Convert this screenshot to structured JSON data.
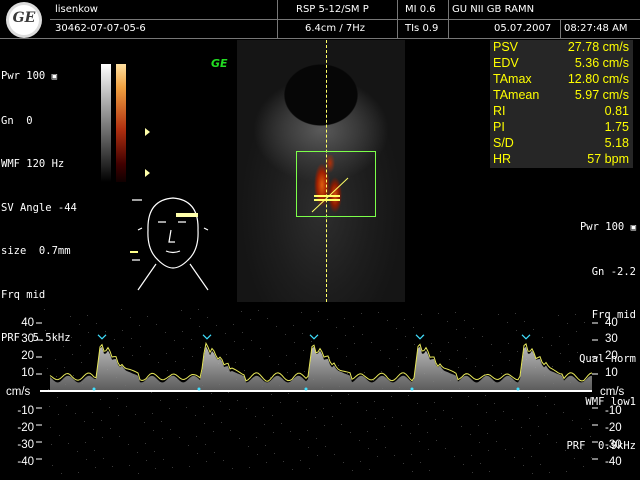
{
  "header": {
    "patient_name": "lisenkow",
    "patient_id": "30462-07-07-05-6",
    "probe": "RSP 5-12/SM P",
    "depth_freq": "6.4cm / 7Hz",
    "mi": "MI  0.6",
    "tis": "TIs  0.9",
    "institution": "GU NII GB RAMN",
    "date": "05.07.2007",
    "time": "08:27:48 AM"
  },
  "left_params": [
    "Pwr 100",
    "Gn  0",
    "WMF 120 Hz",
    "SV Angle -44",
    "size  0.7mm",
    "Frq mid",
    "PRF  5.5kHz"
  ],
  "brand_mark": "GE",
  "measurements": [
    {
      "label": "PSV",
      "value": "27.78 cm/s"
    },
    {
      "label": "EDV",
      "value": "5.36 cm/s"
    },
    {
      "label": "TAmax",
      "value": "12.80 cm/s"
    },
    {
      "label": "TAmean",
      "value": "5.97 cm/s"
    },
    {
      "label": "RI",
      "value": "0.81"
    },
    {
      "label": "PI",
      "value": "1.75"
    },
    {
      "label": "S/D",
      "value": "5.18"
    },
    {
      "label": "HR",
      "value": "57 bpm"
    }
  ],
  "right_params": [
    "Pwr 100",
    "Gn -2.2",
    "Frq mid",
    "Qual norm",
    "WMF low1",
    "PRF  0.9kHz"
  ],
  "doppler_scale": {
    "unit": "cm/s",
    "positive_ticks": [
      "40",
      "30",
      "20",
      "10"
    ],
    "negative_ticks": [
      "-10",
      "-20",
      "-30",
      "-40"
    ]
  },
  "colors": {
    "text": "#ffffff",
    "measurement_text": "#ffff00",
    "roi_box": "#7cff4a",
    "envelope": "#e8e85a",
    "cursor": "#ffff66",
    "peak_marker": "#40e0ff"
  }
}
